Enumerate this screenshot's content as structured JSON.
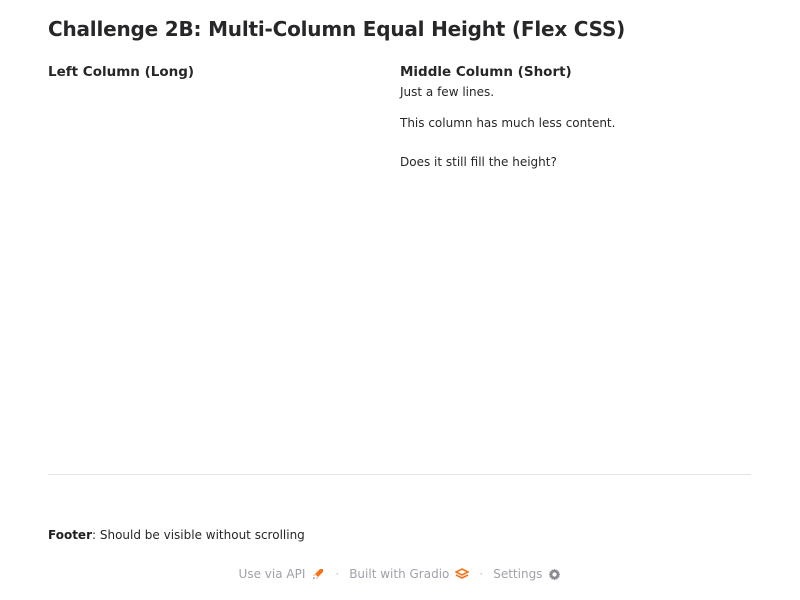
{
  "page": {
    "title": "Challenge 2B: Multi-Column Equal Height (Flex CSS)"
  },
  "columns": {
    "left": {
      "heading": "Left Column (Long)"
    },
    "middle": {
      "heading": "Middle Column (Short)",
      "paragraphs": [
        "Just a few lines.",
        "This column has much less content.",
        "Does it still fill the height?"
      ]
    }
  },
  "footer": {
    "label": "Footer",
    "text": ": Should be visible without scrolling"
  },
  "gradio_footer": {
    "api_label": "Use via API",
    "api_icon": "rocket-icon",
    "separator": "·",
    "built_label": "Built with Gradio",
    "built_icon": "gradio-logo-icon",
    "settings_label": "Settings",
    "settings_icon": "gear-icon"
  },
  "colors": {
    "text": "#27272a",
    "muted": "#a1a1aa",
    "divider": "#e4e4e7",
    "accent": "#f97316"
  }
}
